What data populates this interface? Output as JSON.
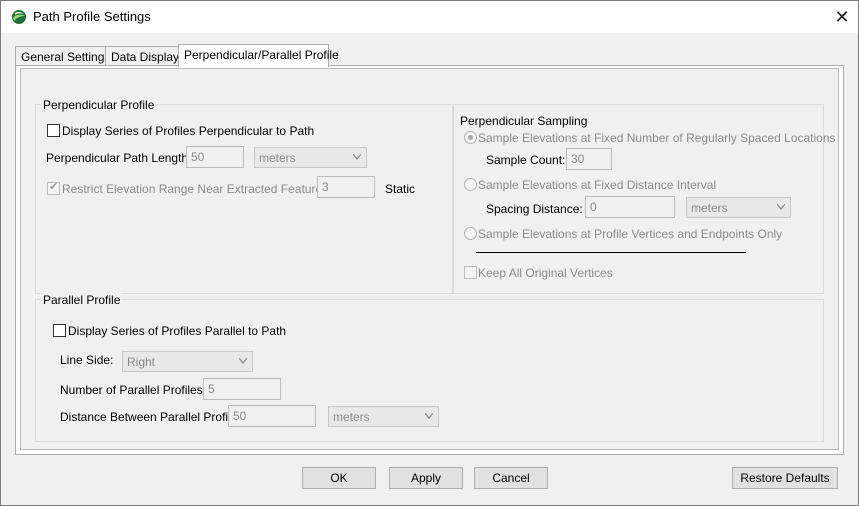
{
  "window": {
    "title": "Path Profile Settings",
    "close_glyph": "✕"
  },
  "tabs": [
    {
      "label": "General Settings"
    },
    {
      "label": "Data Display"
    },
    {
      "label": "Perpendicular/Parallel Profile"
    }
  ],
  "perpendicular": {
    "group_title": "Perpendicular Profile",
    "display_series_label": "Display Series of Profiles Perpendicular to Path",
    "display_series_checked": false,
    "path_length_label": "Perpendicular Path Length:",
    "path_length_value": "50",
    "path_length_units": "meters",
    "restrict_label": "Restrict Elevation Range Near Extracted Features",
    "restrict_checked": true,
    "restrict_value": "3",
    "restrict_mode": "Static"
  },
  "sampling": {
    "group_title": "Perpendicular Sampling",
    "fixed_number_label": "Sample Elevations at Fixed Number of Regularly Spaced Locations",
    "sample_count_label": "Sample Count:",
    "sample_count_value": "30",
    "fixed_distance_label": "Sample Elevations at Fixed Distance Interval",
    "spacing_label": "Spacing Distance:",
    "spacing_value": "0",
    "spacing_units": "meters",
    "vertices_label": "Sample Elevations at Profile Vertices and Endpoints Only",
    "keep_vertices_label": "Keep All Original Vertices"
  },
  "parallel": {
    "group_title": "Parallel Profile",
    "display_series_label": "Display Series of Profiles Parallel to Path",
    "display_series_checked": false,
    "line_side_label": "Line Side:",
    "line_side_value": "Right",
    "num_profiles_label": "Number of Parallel Profiles:",
    "num_profiles_value": "5",
    "distance_label": "Distance Between Parallel Profiles:",
    "distance_value": "50",
    "distance_units": "meters"
  },
  "buttons": {
    "ok": "OK",
    "apply": "Apply",
    "cancel": "Cancel",
    "restore": "Restore Defaults"
  }
}
